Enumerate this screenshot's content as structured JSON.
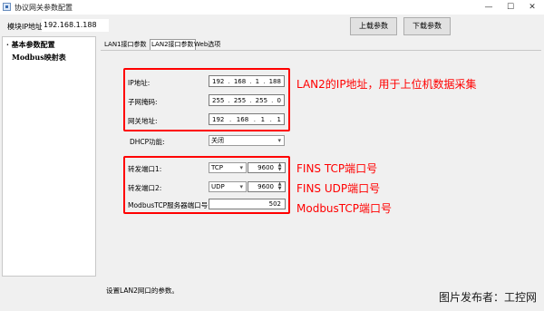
{
  "window": {
    "title": "协议网关参数配置",
    "controls": [
      "—",
      "☐",
      "✕"
    ]
  },
  "toolbar": {
    "ip_label": "模块IP地址",
    "ip_value": "192.168.1.188",
    "upload_label": "上载参数",
    "download_label": "下载参数"
  },
  "tree": {
    "items": [
      {
        "label": "基本参数配置",
        "prefix": "·"
      },
      {
        "label": "Modbus映射表",
        "prefix": ""
      }
    ]
  },
  "tabs": [
    {
      "label": "LAN1接口参数",
      "active": false
    },
    {
      "label": "LAN2接口参数",
      "active": true
    },
    {
      "label": "Web选项",
      "active": false
    }
  ],
  "lan2": {
    "ip_label": "IP地址:",
    "ip": [
      "192",
      "168",
      "1",
      "188"
    ],
    "mask_label": "子网掩码:",
    "mask": [
      "255",
      "255",
      "255",
      "0"
    ],
    "gateway_label": "网关地址:",
    "gateway": [
      "192",
      "168",
      "1",
      "1"
    ],
    "dhcp_label": "DHCP功能:",
    "dhcp_value": "关闭"
  },
  "ports": {
    "port1_label": "转发端口1:",
    "port1_protocol": "TCP",
    "port1_value": "9600",
    "port2_label": "转发端口2:",
    "port2_protocol": "UDP",
    "port2_value": "9600",
    "modbus_label": "ModbusTCP服务器端口号:",
    "modbus_value": "502"
  },
  "annotations": {
    "lan2_note": "LAN2的IP地址，用于上位机数据采集",
    "fins_tcp_note": "FINS TCP端口号",
    "fins_udp_note": "FINS UDP端口号",
    "modbus_note": "ModbusTCP端口号",
    "color": "#ff0000"
  },
  "status": {
    "text": "设置LAN2网口的参数。"
  },
  "watermark": "图片发布者：工控网"
}
